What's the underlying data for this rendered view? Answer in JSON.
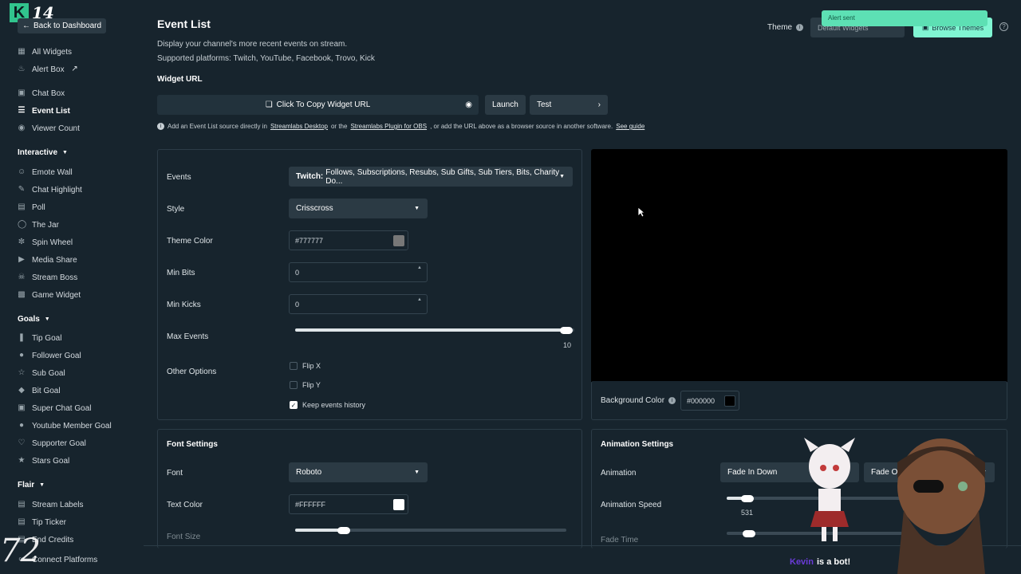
{
  "overlay": {
    "logo_letter": "K",
    "logo_number": "14",
    "corner_number": "72",
    "bot_name": "Kevin",
    "bot_text": "is a bot!"
  },
  "sidebar": {
    "back": "Back to Dashboard",
    "items_top": [
      {
        "label": "All Widgets",
        "icon": "grid-icon"
      },
      {
        "label": "Alert Box",
        "icon": "bell-icon"
      }
    ],
    "items_main": [
      {
        "label": "Chat Box",
        "icon": "chat-icon"
      },
      {
        "label": "Event List",
        "icon": "list-icon"
      },
      {
        "label": "Viewer Count",
        "icon": "eye-icon"
      }
    ],
    "interactive_header": "Interactive",
    "interactive": [
      {
        "label": "Emote Wall",
        "icon": "emote-icon"
      },
      {
        "label": "Chat Highlight",
        "icon": "pen-icon"
      },
      {
        "label": "Poll",
        "icon": "bars-icon"
      },
      {
        "label": "The Jar",
        "icon": "jar-icon"
      },
      {
        "label": "Spin Wheel",
        "icon": "wheel-icon"
      },
      {
        "label": "Media Share",
        "icon": "media-icon"
      },
      {
        "label": "Stream Boss",
        "icon": "boss-icon"
      },
      {
        "label": "Game Widget",
        "icon": "game-icon"
      }
    ],
    "goals_header": "Goals",
    "goals": [
      {
        "label": "Tip Goal"
      },
      {
        "label": "Follower Goal"
      },
      {
        "label": "Sub Goal"
      },
      {
        "label": "Bit Goal"
      },
      {
        "label": "Super Chat Goal"
      },
      {
        "label": "Youtube Member Goal"
      },
      {
        "label": "Supporter Goal"
      },
      {
        "label": "Stars Goal"
      }
    ],
    "flair_header": "Flair",
    "flair": [
      {
        "label": "Stream Labels"
      },
      {
        "label": "Tip Ticker"
      },
      {
        "label": "End Credits"
      },
      {
        "label": "Connect Platforms"
      }
    ]
  },
  "header": {
    "title": "Event List",
    "desc1": "Display your channel's more recent events on stream.",
    "desc2": "Supported platforms: Twitch, YouTube, Facebook, Trovo, Kick",
    "widget_url_label": "Widget URL",
    "copy_url": "Click To Copy Widget URL",
    "launch": "Launch",
    "test": "Test",
    "info_a": "Add an Event List source directly in",
    "info_link1": "Streamlabs Desktop",
    "info_b": "or the",
    "info_link2": "Streamlabs Plugin for OBS",
    "info_c": ", or add the URL above as a browser source in another software.",
    "info_link3": "See guide",
    "theme_label": "Theme",
    "theme_value": "Default Widgets",
    "browse": "Browse Themes",
    "toast": "Alert sent"
  },
  "settings": {
    "events_label": "Events",
    "events_value_bold": "Twitch:",
    "events_value": "Follows, Subscriptions, Resubs, Sub Gifts, Sub Tiers, Bits, Charity Do...",
    "style_label": "Style",
    "style_value": "Crisscross",
    "theme_color_label": "Theme Color",
    "theme_color": "#777777",
    "min_bits_label": "Min Bits",
    "min_bits": "0",
    "min_kicks_label": "Min Kicks",
    "min_kicks": "0",
    "max_events_label": "Max Events",
    "max_events": "10",
    "max_events_level": 1.0,
    "other_label": "Other Options",
    "flip_x": "Flip X",
    "flip_y": "Flip Y",
    "keep_history": "Keep events history"
  },
  "preview": {
    "bg_label": "Background Color",
    "bg_value": "#000000"
  },
  "font": {
    "title": "Font Settings",
    "font_label": "Font",
    "font_value": "Roboto",
    "text_color_label": "Text Color",
    "text_color": "#FFFFFF",
    "font_size_label": "Font Size",
    "font_size_level": 0.18
  },
  "animation": {
    "title": "Animation Settings",
    "anim_label": "Animation",
    "anim_in": "Fade In Down",
    "anim_out": "Fade Out",
    "speed_label": "Animation Speed",
    "speed_value": "531",
    "fade_label": "Fade Time"
  }
}
